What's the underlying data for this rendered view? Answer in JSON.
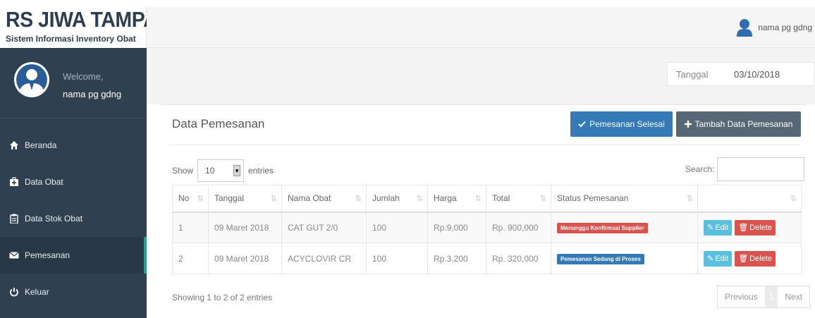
{
  "brand": {
    "title": "RS JIWA TAMPAN",
    "subtitle": "Sistem Informasi Inventory Obat"
  },
  "topbar": {
    "user_name": "nama pg gdng"
  },
  "sidebar": {
    "welcome": "Welcome,",
    "user_name": "nama pg gdng",
    "items": [
      {
        "label": "Beranda",
        "icon": "home-icon"
      },
      {
        "label": "Data Obat",
        "icon": "medkit-icon"
      },
      {
        "label": "Data Stok Obat",
        "icon": "clipboard-icon"
      },
      {
        "label": "Pemesanan",
        "icon": "envelope-icon",
        "active": true
      },
      {
        "label": "Keluar",
        "icon": "power-icon"
      }
    ]
  },
  "datebar": {
    "label": "Tanggal",
    "value": "03/10/2018"
  },
  "panel": {
    "title": "Data Pemesanan",
    "done_button": "Pemesanan Selesai",
    "add_button": "Tambah Data Pemesanan",
    "show_label": "Show",
    "entries_value": "10",
    "entries_label": "entries",
    "search_label": "Search:",
    "columns": [
      "No",
      "Tanggal",
      "Nama Obat",
      "Jumlah",
      "Harga",
      "Total",
      "Status Pemesanan",
      ""
    ],
    "rows": [
      {
        "no": "1",
        "tanggal": "09 Maret 2018",
        "nama_obat": "CAT GUT 2/0",
        "jumlah": "100",
        "harga": "Rp.9,000",
        "total": "Rp. 900,000",
        "status": "Menunggu Konfirmasi Supplier",
        "status_color": "#d9534f"
      },
      {
        "no": "2",
        "tanggal": "09 Maret 2018",
        "nama_obat": "ACYCLOVIR CR",
        "jumlah": "100",
        "harga": "Rp.3,200",
        "total": "Rp. 320,000",
        "status": "Pemesanan Sedang di Proses",
        "status_color": "#337ab7"
      }
    ],
    "edit_label": "Edit",
    "delete_label": "Delete",
    "info": "Showing 1 to 2 of 2 entries",
    "pagination": {
      "previous": "Previous",
      "current": "1",
      "next": "Next"
    }
  }
}
